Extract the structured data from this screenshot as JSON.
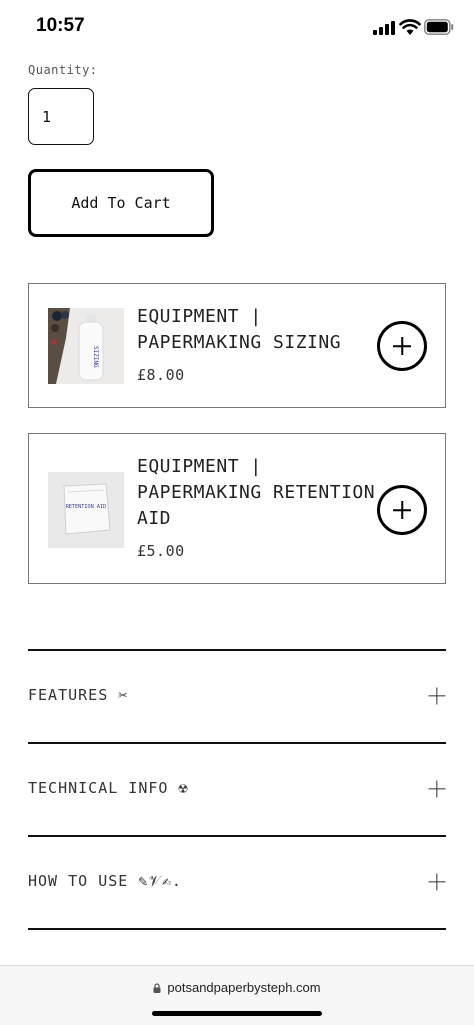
{
  "status_bar": {
    "time": "10:57"
  },
  "quantity": {
    "label": "Quantity:",
    "value": "1"
  },
  "add_to_cart": {
    "label": "Add To Cart"
  },
  "products": [
    {
      "title": "EQUIPMENT | PAPERMAKING SIZING",
      "price": "£8.00",
      "thumb_text": "SIZING"
    },
    {
      "title": "EQUIPMENT | PAPERMAKING RETENTION AID",
      "price": "£5.00",
      "thumb_text": "RETENTION AID"
    }
  ],
  "accordion": [
    {
      "title": "FEATURES ✂"
    },
    {
      "title": "TECHNICAL INFO ☢"
    },
    {
      "title": "HOW TO USE ✎𝒱✍."
    }
  ],
  "browser": {
    "url": "potsandpaperbysteph.com"
  }
}
